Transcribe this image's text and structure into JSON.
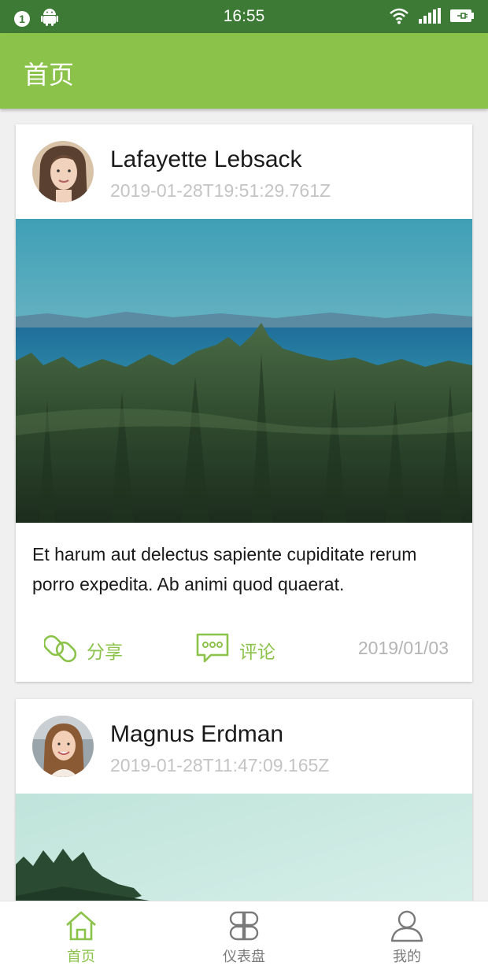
{
  "statusbar": {
    "notification_count": "1",
    "time": "16:55",
    "icons": [
      "notification-badge-icon",
      "android-icon",
      "wifi-icon",
      "signal-icon",
      "battery-charging-icon"
    ]
  },
  "appbar": {
    "title": "首页"
  },
  "posts": [
    {
      "author": "Lafayette Lebsack",
      "timestamp": "2019-01-28T19:51:29.761Z",
      "image": "forest-lake-landscape",
      "body": "Et harum aut delectus sapiente cupiditate rerum porro expedita. Ab animi quod quaerat.",
      "share_label": "分享",
      "comment_label": "评论",
      "date": "2019/01/03"
    },
    {
      "author": "Magnus Erdman",
      "timestamp": "2019-01-28T11:47:09.165Z",
      "image": "misty-treeline-landscape"
    }
  ],
  "colors": {
    "accent": "#8bc34a",
    "statusbar": "#3d7a35",
    "muted": "#c4c4c4"
  },
  "bottom_nav": [
    {
      "label": "首页",
      "icon": "home-icon",
      "active": true
    },
    {
      "label": "仪表盘",
      "icon": "dashboard-icon",
      "active": false
    },
    {
      "label": "我的",
      "icon": "person-icon",
      "active": false
    }
  ]
}
